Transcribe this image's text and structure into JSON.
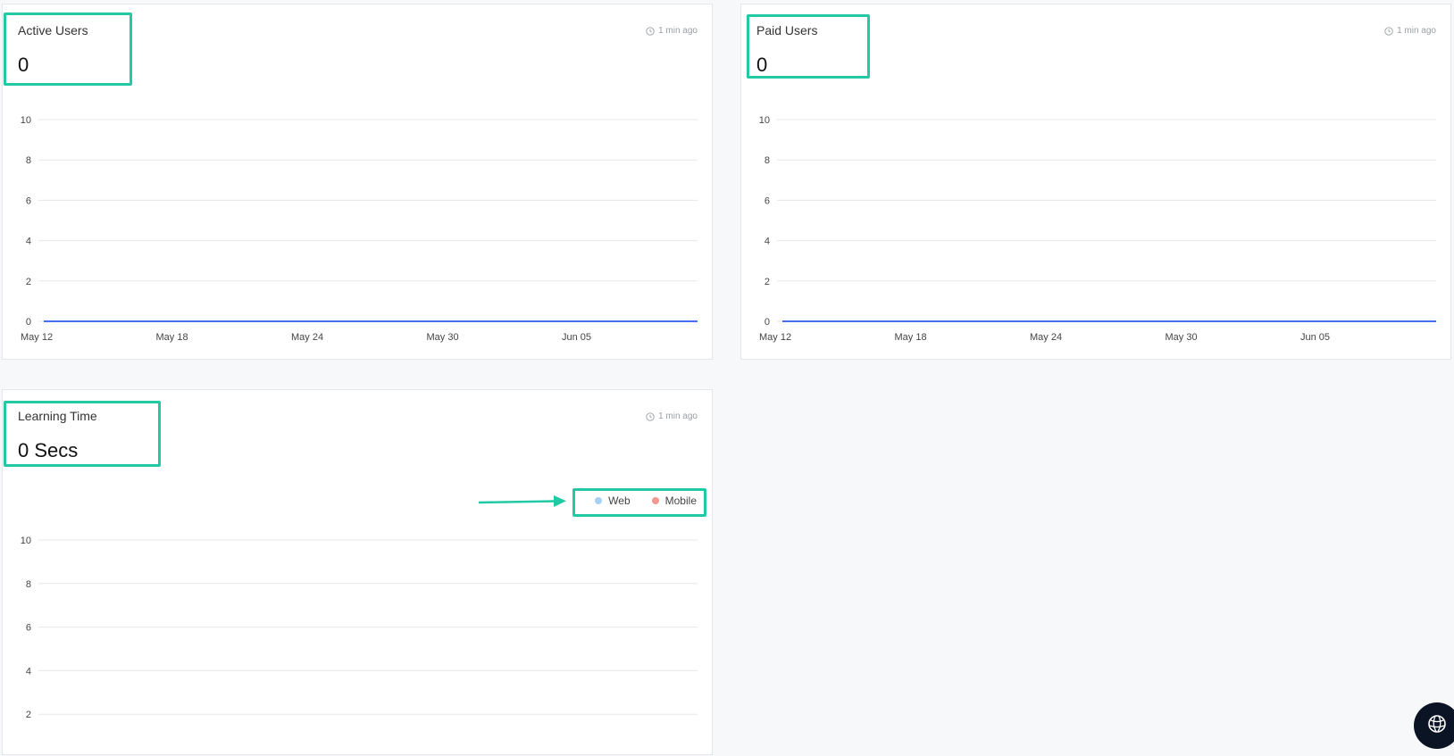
{
  "cards": {
    "active_users": {
      "title": "Active Users",
      "value": "0",
      "updated": "1 min ago"
    },
    "paid_users": {
      "title": "Paid Users",
      "value": "0",
      "updated": "1 min ago"
    },
    "learning_time": {
      "title": "Learning Time",
      "value": "0 Secs",
      "updated": "1 min ago"
    }
  },
  "legend": {
    "web": "Web",
    "mobile": "Mobile",
    "web_color": "#a8d0f5",
    "mobile_color": "#f4978e"
  },
  "colors": {
    "highlight": "#22c9a4",
    "line": "#4a6cf0",
    "grid": "#e5e7eb"
  },
  "icons": {
    "updated": "clock-icon",
    "fab": "globe-icon"
  },
  "chart_data": [
    {
      "type": "line",
      "x_ticks": [
        "May 12",
        "May 18",
        "May 24",
        "May 30",
        "Jun 05"
      ],
      "y_ticks": [
        "0",
        "2",
        "4",
        "6",
        "8",
        "10"
      ],
      "ylim": [
        0,
        10
      ],
      "series": [
        {
          "values": [
            0,
            0,
            0,
            0,
            0,
            0
          ]
        }
      ],
      "grid": true
    },
    {
      "type": "line",
      "x_ticks": [
        "May 12",
        "May 18",
        "May 24",
        "May 30",
        "Jun 05"
      ],
      "y_ticks": [
        "0",
        "2",
        "4",
        "6",
        "8",
        "10"
      ],
      "ylim": [
        0,
        10
      ],
      "series": [
        {
          "values": [
            0,
            0,
            0,
            0,
            0,
            0
          ]
        }
      ],
      "grid": true
    },
    {
      "type": "bar",
      "y_ticks": [
        "2",
        "4",
        "6",
        "8",
        "10"
      ],
      "ylim": [
        0,
        10
      ],
      "series": [
        {
          "name": "Web",
          "values": []
        },
        {
          "name": "Mobile",
          "values": []
        }
      ],
      "grid": true
    }
  ]
}
